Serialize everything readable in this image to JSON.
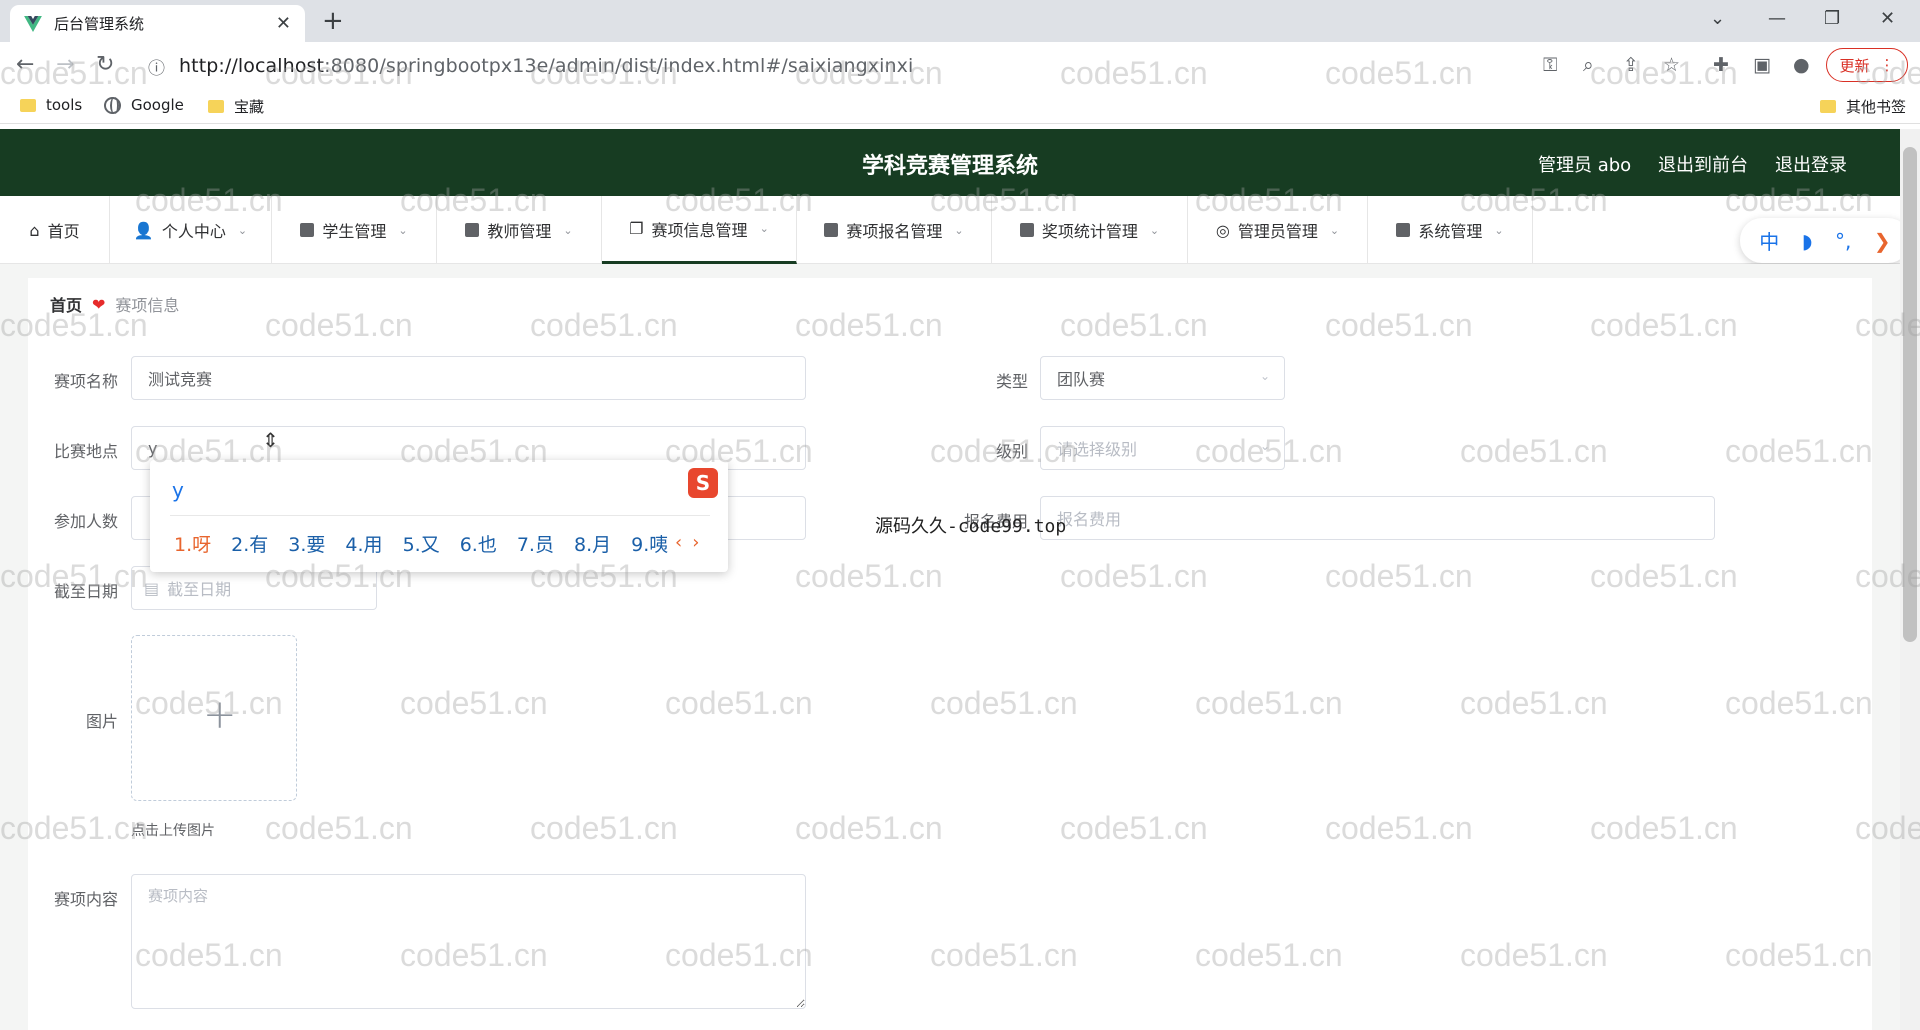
{
  "browser": {
    "tab_title": "后台管理系统",
    "url_host": "http://localhost",
    "url_rest": ":8080/springbootpx13e/admin/dist/index.html#/saixiangxinxi",
    "update_label": "更新",
    "bookmarks": [
      "tools",
      "Google",
      "宝藏"
    ],
    "other_bookmarks": "其他书签"
  },
  "header": {
    "title": "学科竞赛管理系统",
    "user": "管理员 abo",
    "exit_front": "退出到前台",
    "logout": "退出登录"
  },
  "menu": [
    {
      "label": "首页"
    },
    {
      "label": "个人中心"
    },
    {
      "label": "学生管理"
    },
    {
      "label": "教师管理"
    },
    {
      "label": "赛项信息管理"
    },
    {
      "label": "赛项报名管理"
    },
    {
      "label": "奖项统计管理"
    },
    {
      "label": "管理员管理"
    },
    {
      "label": "系统管理"
    }
  ],
  "ime_toolbar": {
    "lang": "中",
    "moon": "◗",
    "punct": "°,",
    "arrow": "❯"
  },
  "breadcrumb": {
    "home": "首页",
    "current": "赛项信息"
  },
  "form": {
    "name_label": "赛项名称",
    "name_value": "测试竞赛",
    "type_label": "类型",
    "type_value": "团队赛",
    "location_label": "比赛地点",
    "location_value": "y",
    "level_label": "级别",
    "level_placeholder": "请选择级别",
    "count_label": "参加人数",
    "fee_label": "报名费用",
    "fee_placeholder": "报名费用",
    "deadline_label": "截至日期",
    "deadline_placeholder": "截至日期",
    "image_label": "图片",
    "upload_tip": "点击上传图片",
    "content_label": "赛项内容",
    "content_placeholder": "赛项内容"
  },
  "ime": {
    "composition": "y",
    "candidates": [
      "1.呀",
      "2.有",
      "3.要",
      "4.用",
      "5.又",
      "6.也",
      "7.员",
      "8.月",
      "9.咦"
    ]
  },
  "overlay_text": "源码久久-code99.top",
  "watermark": "code51.cn",
  "colors": {
    "header_bg": "#173c22",
    "accent_heart": "#e62b2b",
    "ime_highlight": "#e8652e"
  }
}
